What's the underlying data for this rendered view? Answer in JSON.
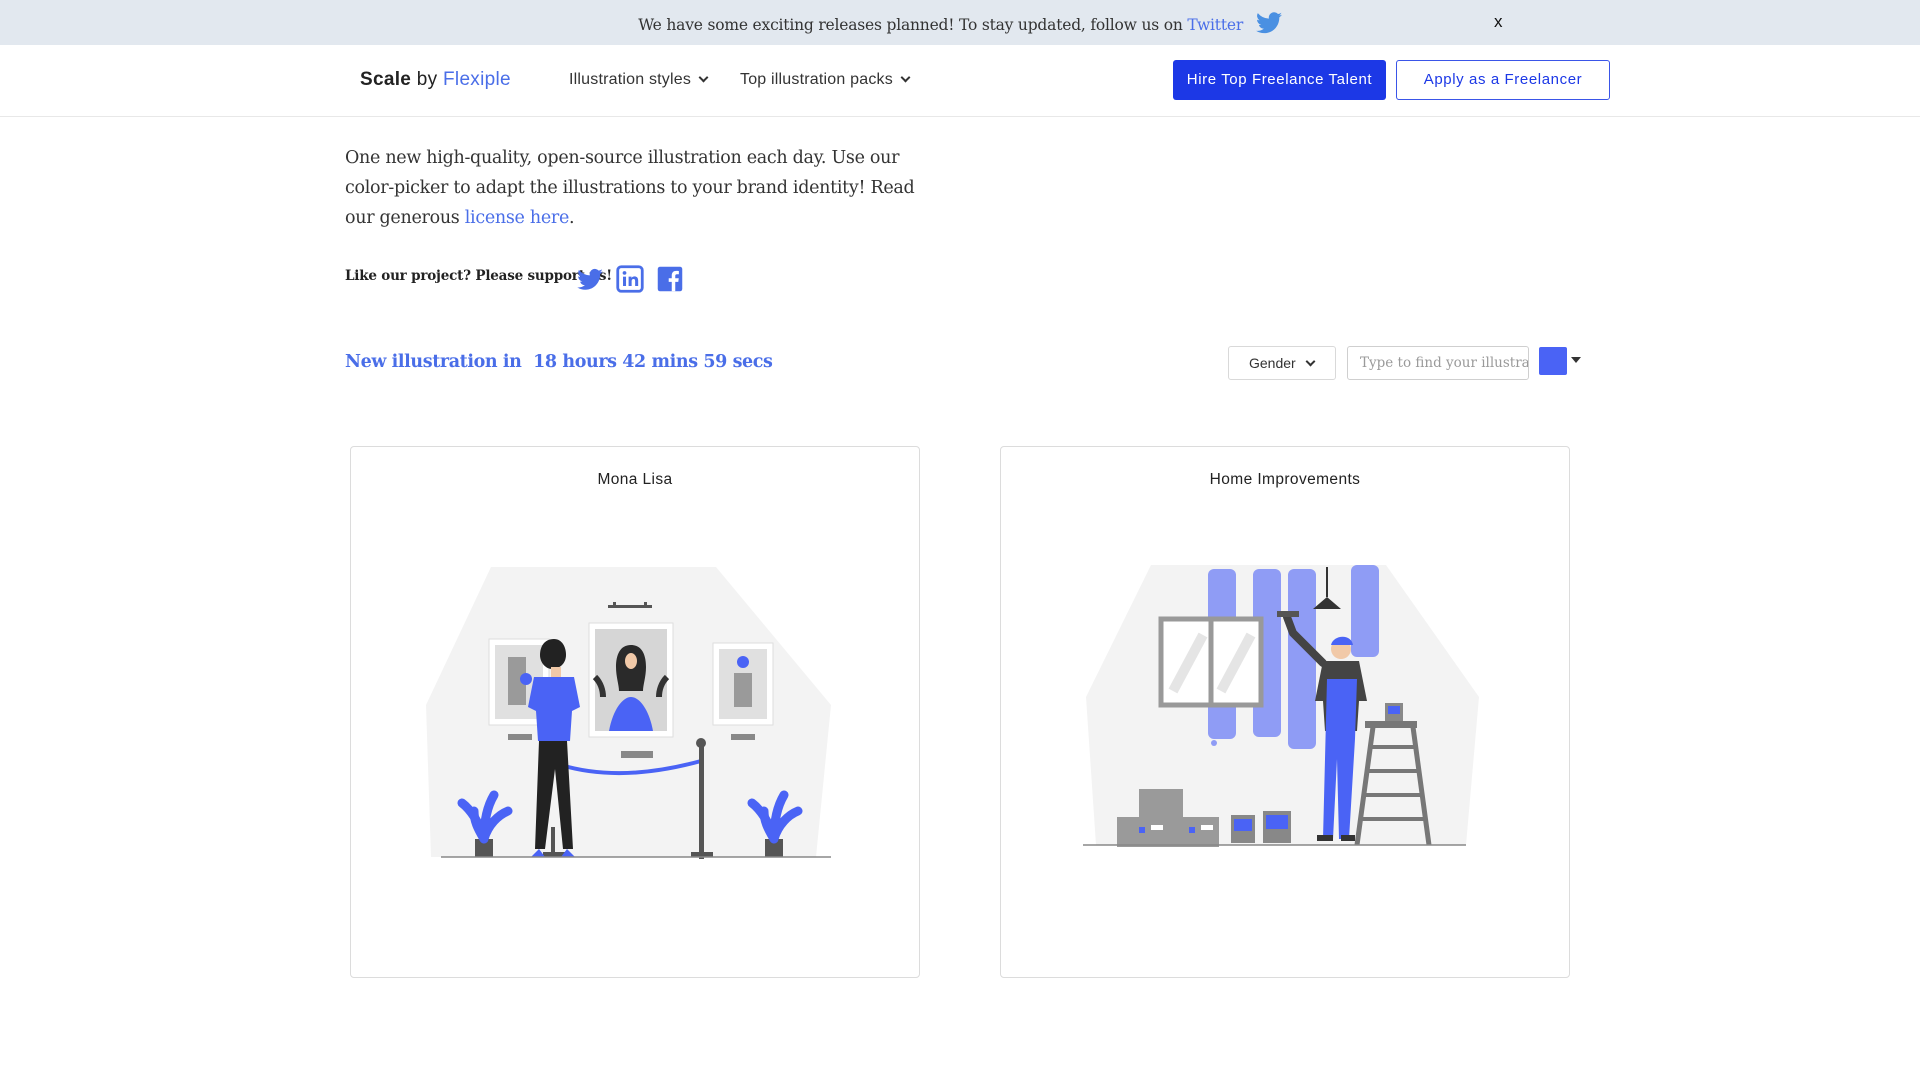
{
  "announcement": {
    "text": "We have some exciting releases planned! To stay updated, follow us on",
    "link": "Twitter",
    "close": "x"
  },
  "header": {
    "brand_strong": "Scale",
    "brand_by": "by",
    "brand_name": "Flexiple",
    "nav": [
      {
        "label": "Illustration styles"
      },
      {
        "label": "Top illustration packs"
      }
    ],
    "hire_button": "Hire Top Freelance Talent",
    "apply_button": "Apply as a Freelancer"
  },
  "intro": {
    "text": "One new high-quality, open-source illustration each day. Use our color-picker to adapt the illustrations to your brand identity! Read our generous",
    "link": "license here",
    "end": "."
  },
  "support": {
    "label": "Like our project? Please support us!",
    "icons": [
      "twitter-icon",
      "linkedin-icon",
      "facebook-icon"
    ]
  },
  "countdown": {
    "label": "New illustration in",
    "time": "18 hours 42 mins 59 secs"
  },
  "filters": {
    "gender_label": "Gender",
    "search_placeholder": "Type to find your illustration",
    "selected_color": "#4a63f5"
  },
  "cards": [
    {
      "title": "Mona Lisa"
    },
    {
      "title": "Home Improvements"
    }
  ],
  "colors": {
    "accent": "#4a63f5",
    "link": "#4a6ee8",
    "hire_button": "#1c38e6",
    "announce_bg": "#e2e8ef"
  }
}
